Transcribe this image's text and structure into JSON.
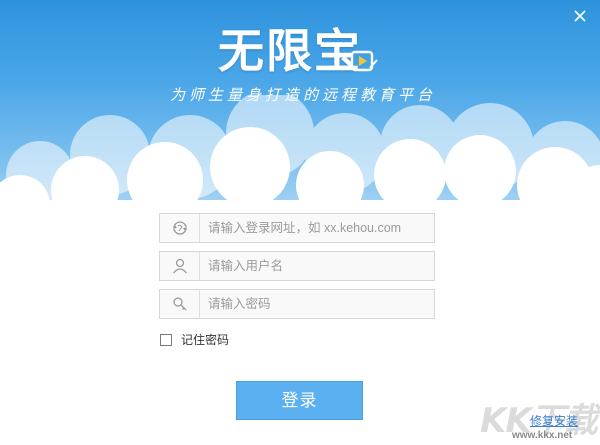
{
  "app": {
    "logo_text": "无限宝",
    "slogan": "为师生量身打造的远程教育平台"
  },
  "window": {
    "close_label": "×"
  },
  "form": {
    "url_placeholder": "请输入登录网址，如 xx.kehou.com",
    "username_placeholder": "请输入用户名",
    "password_placeholder": "请输入密码",
    "remember_label": "记住密码",
    "remember_checked": false,
    "login_label": "登录"
  },
  "footer": {
    "repair_link": "修复安装"
  },
  "watermark": {
    "logo_text": "KK下载",
    "url": "www.kkx.net"
  },
  "icons": {
    "url_field": "refresh-globe-icon",
    "username_field": "user-icon",
    "password_field": "key-icon",
    "logo_badge": "play-pencil-icon"
  },
  "colors": {
    "sky_top": "#2e93dd",
    "sky_bottom": "#b9dcf6",
    "login_button": "#5ab0f0",
    "link": "#3a7fd0"
  }
}
